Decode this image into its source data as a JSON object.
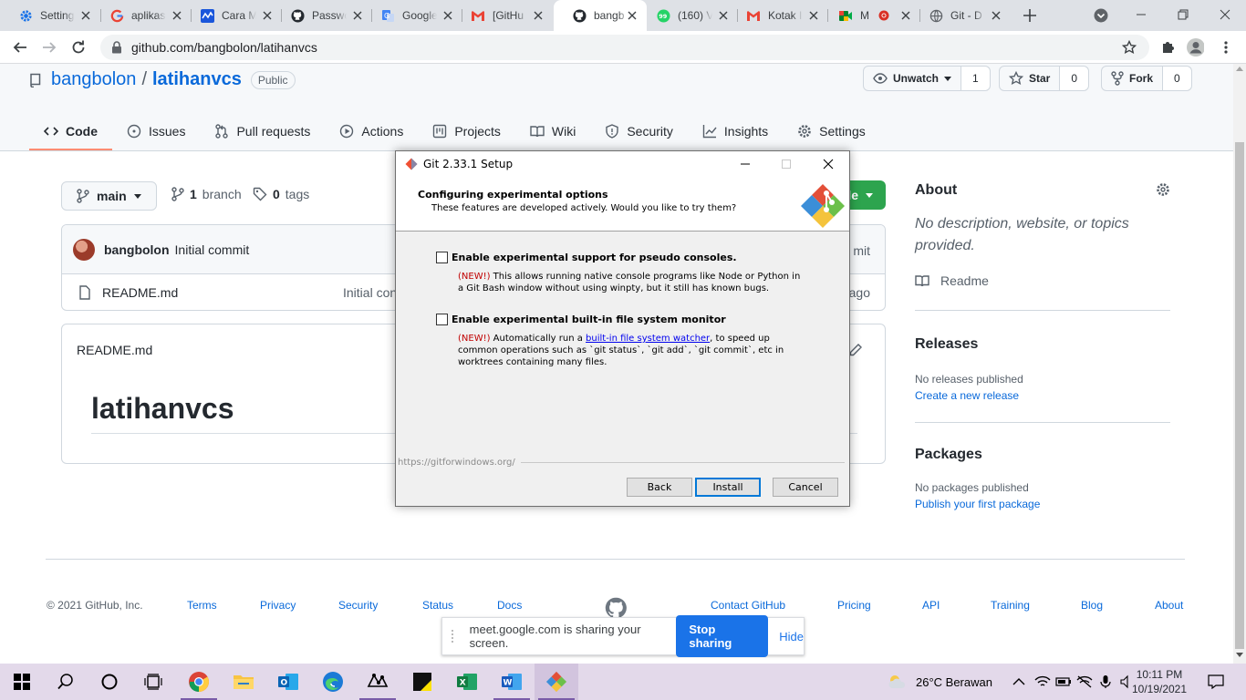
{
  "browser": {
    "tabs": [
      {
        "title": "Settings",
        "icon": "gear-icon"
      },
      {
        "title": "aplikasi",
        "icon": "google-icon"
      },
      {
        "title": "Cara M",
        "icon": "wave-icon"
      },
      {
        "title": "Passwo",
        "icon": "github-icon"
      },
      {
        "title": "Google",
        "icon": "google-translate-icon"
      },
      {
        "title": "[GitHu",
        "icon": "gmail-icon"
      },
      {
        "title": "bangb",
        "icon": "github-icon"
      },
      {
        "title": "(160) V",
        "icon": "whatsapp-icon"
      },
      {
        "title": "Kotak I",
        "icon": "gmail-icon"
      },
      {
        "title": "M",
        "icon": "meet-icon"
      },
      {
        "title": "Git - D",
        "icon": "globe-icon"
      }
    ],
    "address": "github.com/bangbolon/latihanvcs"
  },
  "repo": {
    "owner": "bangbolon",
    "separator": "/",
    "name": "latihanvcs",
    "visibility": "Public",
    "watch_label": "Unwatch",
    "watch_count": "1",
    "star_label": "Star",
    "star_count": "0",
    "fork_label": "Fork",
    "fork_count": "0",
    "nav": [
      {
        "label": "Code",
        "icon": "code-icon"
      },
      {
        "label": "Issues",
        "icon": "issue-icon"
      },
      {
        "label": "Pull requests",
        "icon": "pull-request-icon"
      },
      {
        "label": "Actions",
        "icon": "play-icon"
      },
      {
        "label": "Projects",
        "icon": "project-icon"
      },
      {
        "label": "Wiki",
        "icon": "book-icon"
      },
      {
        "label": "Security",
        "icon": "shield-icon"
      },
      {
        "label": "Insights",
        "icon": "graph-icon"
      },
      {
        "label": "Settings",
        "icon": "gear-icon"
      }
    ],
    "branch": "main",
    "branch_count": "1",
    "branch_word": "branch",
    "tag_count": "0",
    "tag_word": "tags",
    "code_btn_fragment": "le",
    "commit_author": "bangbolon",
    "commit_message": "Initial commit",
    "commit_right_fragment": "mit",
    "file_name": "README.md",
    "file_commit_fragment": "Initial con",
    "file_age_fragment": "ago",
    "readme_header": "README.md",
    "readme_title": "latihanvcs"
  },
  "sidebar": {
    "about_title": "About",
    "about_desc": "No description, website, or topics provided.",
    "readme_link": "Readme",
    "releases_title": "Releases",
    "releases_none": "No releases published",
    "releases_create": "Create a new release",
    "packages_title": "Packages",
    "packages_none": "No packages published",
    "packages_publish": "Publish your first package"
  },
  "footer": {
    "copyright": "© 2021 GitHub, Inc.",
    "left_links": [
      "Terms",
      "Privacy",
      "Security",
      "Status",
      "Docs"
    ],
    "right_links": [
      "Contact GitHub",
      "Pricing",
      "API",
      "Training",
      "Blog",
      "About"
    ]
  },
  "share_banner": {
    "text": "meet.google.com is sharing your screen.",
    "stop": "Stop sharing",
    "hide": "Hide"
  },
  "dialog": {
    "title": "Git 2.33.1 Setup",
    "heading": "Configuring experimental options",
    "subheading": "These features are developed actively. Would you like to try them?",
    "option1": {
      "label": "Enable experimental support for pseudo consoles.",
      "new_tag": "(NEW!)",
      "desc": " This allows running native console programs like Node or Python in a Git Bash window without using winpty, but it still has known bugs.",
      "checked": false
    },
    "option2": {
      "label": "Enable experimental built-in file system monitor",
      "new_tag": "(NEW!)",
      "desc_pre": " Automatically run a ",
      "link": "built-in file system watcher",
      "desc_post": ", to speed up common operations such as `git status`, `git add`, `git commit`, etc in worktrees containing many files.",
      "checked": false
    },
    "url": "https://gitforwindows.org/",
    "back": "Back",
    "install": "Install",
    "cancel": "Cancel"
  },
  "taskbar": {
    "weather": "26°C  Berawan",
    "time": "10:11 PM",
    "date": "10/19/2021"
  }
}
